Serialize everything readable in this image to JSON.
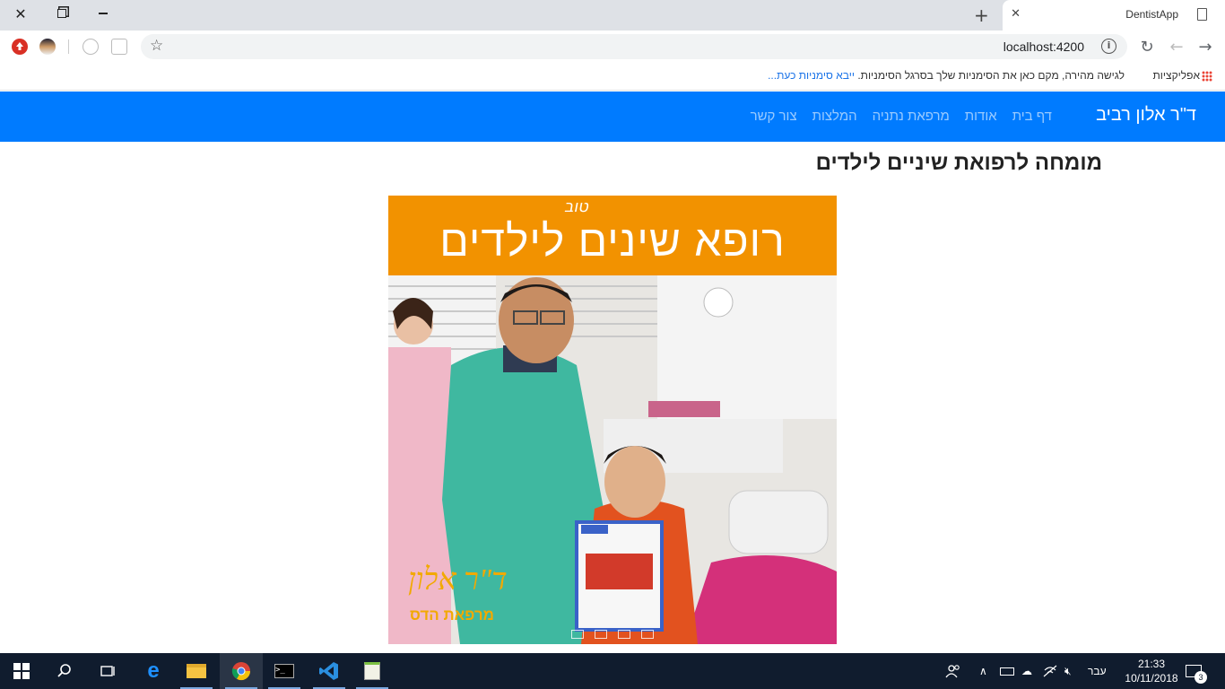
{
  "browser": {
    "tab_title": "DentistApp",
    "url": "localhost:4200",
    "bookmarks_apps_label": "אפליקציות",
    "bookmarks_hint": "לגישה מהירה, מקם כאן את הסימניות שלך בסרגל הסימניות.",
    "bookmarks_import_link": "ייבא סימניות כעת..."
  },
  "navbar": {
    "brand": "ד\"ר אלון רביב",
    "links": [
      "דף בית",
      "אודות",
      "מרפאת נתניה",
      "המלצות",
      "צור קשר"
    ]
  },
  "main": {
    "heading": "מומחה לרפואת שיניים לילדים",
    "hero": {
      "banner_text": "רופא שינים לילדים",
      "banner_script": "טוב",
      "logo_main": "ד\"ר אלון",
      "logo_sub": "מרפאת הדס",
      "slide_count": 4
    }
  },
  "taskbar": {
    "language": "עבר",
    "time": "21:33",
    "date": "10/11/2018",
    "notifications": "3"
  },
  "colors": {
    "navbar": "#007bff",
    "banner": "#f29200",
    "taskbar": "#101c2e"
  }
}
